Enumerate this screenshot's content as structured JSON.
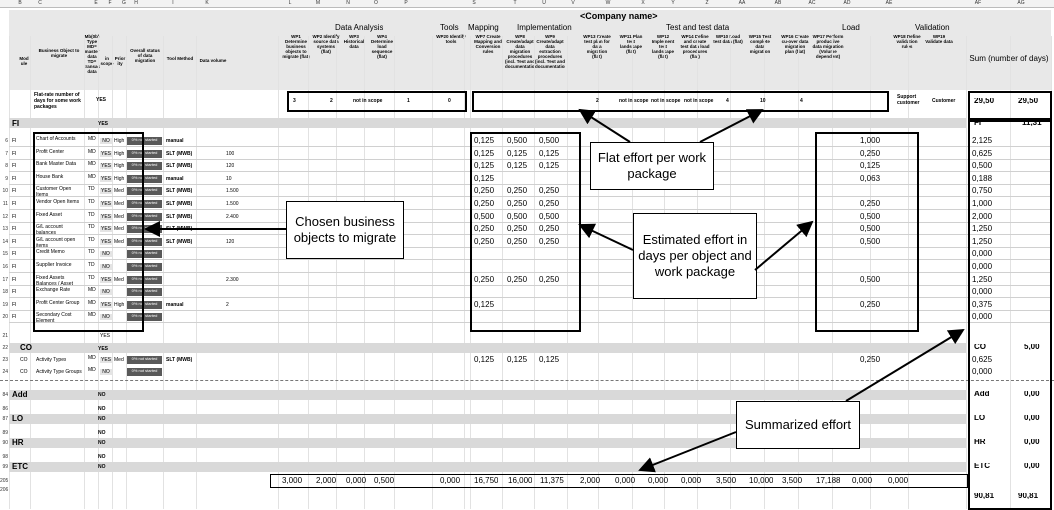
{
  "columns": [
    "B",
    "C",
    "E",
    "F",
    "G",
    "H",
    "I",
    "K",
    "L",
    "M",
    "N",
    "O",
    "P",
    "S",
    "T",
    "U",
    "V",
    "W",
    "X",
    "Y",
    "Z",
    "AA",
    "AB",
    "AC",
    "AD",
    "AE",
    "AF",
    "AG"
  ],
  "company": "<Company name>",
  "groups": {
    "data_analysis": "Data Analysis",
    "tools": "Tools",
    "mapping": "Mapping",
    "implementation": "Implementation",
    "test": "Test and test data",
    "load": "Load",
    "validation": "Validation"
  },
  "headers": {
    "module": "Mod ule",
    "business_object": "Business Object to migrate",
    "type": "Mb(0b) Type MD= master data TD= transaction data",
    "in_scope": "in scope",
    "priority": "Prior ity",
    "overall": "Overall status of data migration",
    "tool": "Tool Method",
    "volume": "Data volume",
    "wp1": "WP1 Determine business objects to migrate (flat)",
    "wp2": "WP2 Identify source data systems (flat)",
    "wp3": "WP3 Historical data",
    "wp4": "WP4 Determine load sequence (flat)",
    "wp20": "WP20 Identify tools",
    "wp7": "WP7 Create Mapping and Conversion rules",
    "wp8": "WP8 Create/adapt data migration procedures (incl. Test and documentation)",
    "wp9": "WP9 Create/adapt data extraction procedures (incl. Test and documentation)",
    "wp13": "WP13 Create test plan for data migration (flat)",
    "wp11": "WP11 Plan test landscape (flat)",
    "wp12": "WP12 Implement test landscape (flat)",
    "wp14": "WP14 Define and create test data load procedures (flat)",
    "wp10": "WP10 Load test data (flat)",
    "wp15": "WP15 Test complete data migration",
    "wp16": "WP16 Create cu-over data migration plan (flat)",
    "wp17": "WP17 Perform productive data migration (Volume dependent)",
    "wp18": "WP18 Define validation rules",
    "wp19": "WP19 Validate data",
    "sum": "Sum (number of days)"
  },
  "flat_row": {
    "label": "Flat-rate number of days for some work packages",
    "in_scope": "YES",
    "wp1": "3",
    "wp2": "2",
    "wp3": "not in scope",
    "wp4": "1",
    "wp20": "0",
    "wp13": "2",
    "wp11": "not in scope",
    "wp12": "not in scope",
    "wp14": "not in scope",
    "wp10": "4",
    "wp15": "10",
    "wp16": "4",
    "support": "Support customer",
    "customer": "Customer",
    "sum1": "29,50",
    "sum2": "29,50"
  },
  "fi_header": {
    "module": "FI",
    "in_scope": "YES",
    "sum_label": "FI",
    "sum_value": "11,31"
  },
  "rows": [
    {
      "n": "6",
      "m": "FI",
      "obj": "Chart of Accounts",
      "t": "MD",
      "s": "NO",
      "p": "High",
      "st": "0% not started",
      "tool": "manual",
      "vol": "",
      "s1": "0,125",
      "t1": "0,500",
      "u1": "0,500",
      "ac": "1,000",
      "af": "2,125"
    },
    {
      "n": "7",
      "m": "FI",
      "obj": "Profit Center",
      "t": "MD",
      "s": "YES",
      "p": "High",
      "st": "0% not started",
      "tool": "SLT (MWB)",
      "vol": "100",
      "s1": "0,125",
      "t1": "0,125",
      "u1": "0,125",
      "ac": "0,250",
      "af": "0,625"
    },
    {
      "n": "8",
      "m": "FI",
      "obj": "Bank Master Data",
      "t": "MD",
      "s": "YES",
      "p": "High",
      "st": "0% not started",
      "tool": "SLT (MWB)",
      "vol": "120",
      "s1": "0,125",
      "t1": "0,125",
      "u1": "0,125",
      "ac": "0,125",
      "af": "0,500"
    },
    {
      "n": "9",
      "m": "FI",
      "obj": "House Bank",
      "t": "MD",
      "s": "YES",
      "p": "High",
      "st": "0% not started",
      "tool": "manual",
      "vol": "10",
      "s1": "0,125",
      "t1": "",
      "u1": "",
      "ac": "0,063",
      "af": "0,188"
    },
    {
      "n": "10",
      "m": "FI",
      "obj": "Customer Open Items",
      "t": "TD",
      "s": "YES",
      "p": "Med",
      "st": "0% not started",
      "tool": "SLT (MWB)",
      "vol": "1.500",
      "s1": "0,250",
      "t1": "0,250",
      "u1": "0,250",
      "ac": "",
      "af": "0,750"
    },
    {
      "n": "11",
      "m": "FI",
      "obj": "Vendor Open Items",
      "t": "TD",
      "s": "YES",
      "p": "Med",
      "st": "0% not started",
      "tool": "SLT (MWB)",
      "vol": "1.500",
      "s1": "0,250",
      "t1": "0,250",
      "u1": "0,250",
      "ac": "0,250",
      "af": "1,000"
    },
    {
      "n": "12",
      "m": "FI",
      "obj": "Fixed Asset",
      "t": "TD",
      "s": "YES",
      "p": "Med",
      "st": "0% not started",
      "tool": "SLT (MWB)",
      "vol": "2.400",
      "s1": "0,500",
      "t1": "0,500",
      "u1": "0,500",
      "ac": "0,500",
      "af": "2,000"
    },
    {
      "n": "13",
      "m": "FI",
      "obj": "G/L account balances",
      "t": "TD",
      "s": "YES",
      "p": "Med",
      "st": "0% not started",
      "tool": "SLT (MWB)",
      "vol": "",
      "s1": "0,250",
      "t1": "0,250",
      "u1": "0,250",
      "ac": "0,500",
      "af": "1,250"
    },
    {
      "n": "14",
      "m": "FI",
      "obj": "G/L account open items",
      "t": "TD",
      "s": "YES",
      "p": "Med",
      "st": "0% not started",
      "tool": "SLT (MWB)",
      "vol": "120",
      "s1": "0,250",
      "t1": "0,250",
      "u1": "0,250",
      "ac": "0,500",
      "af": "1,250"
    },
    {
      "n": "15",
      "m": "FI",
      "obj": "Credit Memo",
      "t": "TD",
      "s": "NO",
      "p": "",
      "st": "0% not started",
      "tool": "",
      "vol": "",
      "s1": "",
      "t1": "",
      "u1": "",
      "ac": "",
      "af": "0,000"
    },
    {
      "n": "16",
      "m": "FI",
      "obj": "Supplier Invoice",
      "t": "TD",
      "s": "NO",
      "p": "",
      "st": "0% not started",
      "tool": "",
      "vol": "",
      "s1": "",
      "t1": "",
      "u1": "",
      "ac": "",
      "af": "0,000"
    },
    {
      "n": "17",
      "m": "FI",
      "obj": "Fixed Assets Balances / Asset",
      "t": "TD",
      "s": "YES",
      "p": "Med",
      "st": "0% not started",
      "tool": "",
      "vol": "2.300",
      "s1": "0,250",
      "t1": "0,250",
      "u1": "0,250",
      "ac": "0,500",
      "af": "1,250"
    },
    {
      "n": "18",
      "m": "FI",
      "obj": "Exchange Rate",
      "t": "MD",
      "s": "NO",
      "p": "",
      "st": "0% not started",
      "tool": "",
      "vol": "",
      "s1": "",
      "t1": "",
      "u1": "",
      "ac": "",
      "af": "0,000"
    },
    {
      "n": "19",
      "m": "FI",
      "obj": "Profit Center Group",
      "t": "MD",
      "s": "YES",
      "p": "High",
      "st": "0% not started",
      "tool": "manual",
      "vol": "2",
      "s1": "0,125",
      "t1": "",
      "u1": "",
      "ac": "0,250",
      "af": "0,375"
    },
    {
      "n": "20",
      "m": "FI",
      "obj": "Secondary Cost Element",
      "t": "MD",
      "s": "NO",
      "p": "",
      "st": "0% not started",
      "tool": "",
      "vol": "",
      "s1": "",
      "t1": "",
      "u1": "",
      "ac": "",
      "af": "0,000"
    }
  ],
  "row21": {
    "n": "21",
    "s": "YES"
  },
  "co_header": {
    "n": "22",
    "module": "CO",
    "in_scope": "YES",
    "sum_label": "CO",
    "sum_value": "5,00"
  },
  "co_rows": [
    {
      "n": "23",
      "m": "CO",
      "obj": "Activity Types",
      "t": "MD",
      "s": "YES",
      "p": "Med",
      "st": "0% not started",
      "tool": "SLT (MWB)",
      "s1": "0,125",
      "t1": "0,125",
      "u1": "0,125",
      "ac": "0,250",
      "af": "0,625"
    },
    {
      "n": "24",
      "m": "CO",
      "obj": "Activity Type Groups",
      "t": "MD",
      "s": "NO",
      "p": "",
      "st": "0% not started",
      "tool": "",
      "s1": "",
      "t1": "",
      "u1": "",
      "ac": "",
      "af": "0,000"
    }
  ],
  "lower": [
    {
      "n": "84",
      "label": "Add",
      "scope": "NO",
      "sum_label": "Add",
      "sum_value": "0,00",
      "grey": true
    },
    {
      "n": "86",
      "label": "",
      "scope": "NO",
      "sum_label": "",
      "sum_value": "",
      "grey": false
    },
    {
      "n": "87",
      "label": "LO",
      "scope": "NO",
      "sum_label": "LO",
      "sum_value": "0,00",
      "grey": true
    },
    {
      "n": "89",
      "label": "",
      "scope": "NO",
      "sum_label": "",
      "sum_value": "",
      "grey": false
    },
    {
      "n": "90",
      "label": "HR",
      "scope": "NO",
      "sum_label": "HR",
      "sum_value": "0,00",
      "grey": true
    },
    {
      "n": "98",
      "label": "",
      "scope": "NO",
      "sum_label": "",
      "sum_value": "",
      "grey": false
    },
    {
      "n": "99",
      "label": "ETC",
      "scope": "NO",
      "sum_label": "ETC",
      "sum_value": "0,00",
      "grey": true
    }
  ],
  "totals": {
    "n1": "205",
    "n2": "206",
    "l": "3,000",
    "m": "2,000",
    "n": "0,000",
    "o": "0,500",
    "p": "0,000",
    "s": "16,750",
    "t": "16,000",
    "u": "11,375",
    "v": "2,000",
    "w": "0,000",
    "x": "0,000",
    "y": "0,000",
    "z": "3,500",
    "aa": "10,000",
    "ab": "3,500",
    "ac": "17,188",
    "ad": "0,000",
    "ae": "0,000",
    "af": "90,81",
    "ag": "90,81"
  },
  "callouts": {
    "flat": "Flat effort per work package",
    "chosen": "Chosen business objects to migrate",
    "estimated": "Estimated effort in days per object and work package",
    "summarized": "Summarized effort"
  }
}
